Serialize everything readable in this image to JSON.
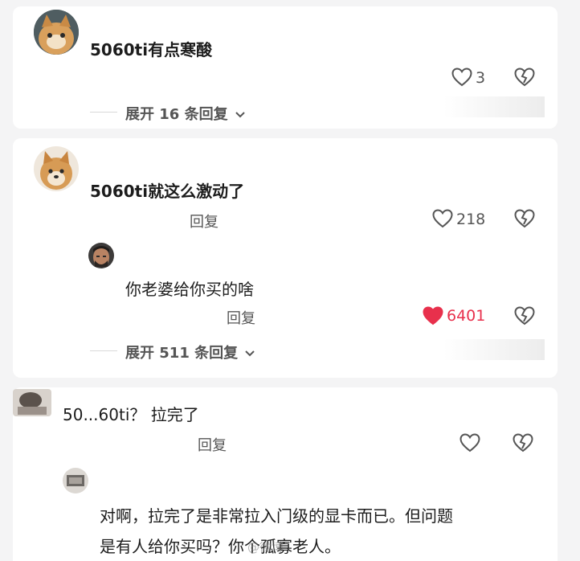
{
  "comments": [
    {
      "text": "5060ti有点寒酸",
      "likes": "3",
      "expand": "展开 16 条回复"
    },
    {
      "text": "5060ti就这么激动了",
      "reply": "回复",
      "likes": "218",
      "sub": {
        "text": "你老婆给你买的啥",
        "reply": "回复",
        "likes": "6401"
      },
      "expand": "展开 511 条回复"
    },
    {
      "text": "50...60ti？ 拉完了",
      "reply": "回复",
      "sub": {
        "line1": "对啊，拉完了是非常拉入门级的显卡而已。但问题",
        "line2": "是有人给你买吗？你个孤寡老人。"
      }
    }
  ],
  "watermark": "@微博",
  "colors": {
    "liked": "#e8304c",
    "muted": "#555555",
    "background": "#f4f4f5"
  },
  "icons": [
    "heart-icon",
    "heart-filled-icon",
    "broken-heart-icon",
    "chevron-down-icon"
  ]
}
